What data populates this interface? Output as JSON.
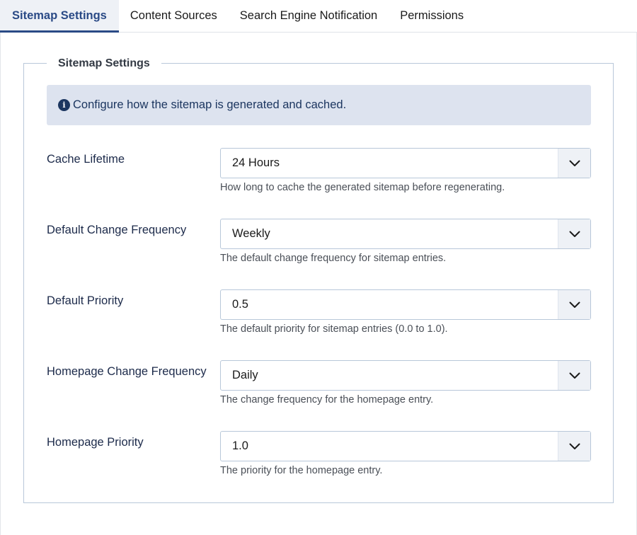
{
  "tabs": [
    {
      "label": "Sitemap Settings",
      "active": true
    },
    {
      "label": "Content Sources",
      "active": false
    },
    {
      "label": "Search Engine Notification",
      "active": false
    },
    {
      "label": "Permissions",
      "active": false
    }
  ],
  "panel": {
    "legend": "Sitemap Settings",
    "info_text": "Configure how the sitemap is generated and cached.",
    "info_icon": "info-circle-icon",
    "fields": [
      {
        "label": "Cache Lifetime",
        "value": "24 Hours",
        "description": "How long to cache the generated sitemap before regenerating."
      },
      {
        "label": "Default Change Frequency",
        "value": "Weekly",
        "description": "The default change frequency for sitemap entries."
      },
      {
        "label": "Default Priority",
        "value": "0.5",
        "description": "The default priority for sitemap entries (0.0 to 1.0)."
      },
      {
        "label": "Homepage Change Frequency",
        "value": "Daily",
        "description": "The change frequency for the homepage entry."
      },
      {
        "label": "Homepage Priority",
        "value": "1.0",
        "description": "The priority for the homepage entry."
      }
    ]
  },
  "colors": {
    "accent": "#2a4a86",
    "info_bg": "#dde3ef",
    "border": "#b8c7d9"
  }
}
